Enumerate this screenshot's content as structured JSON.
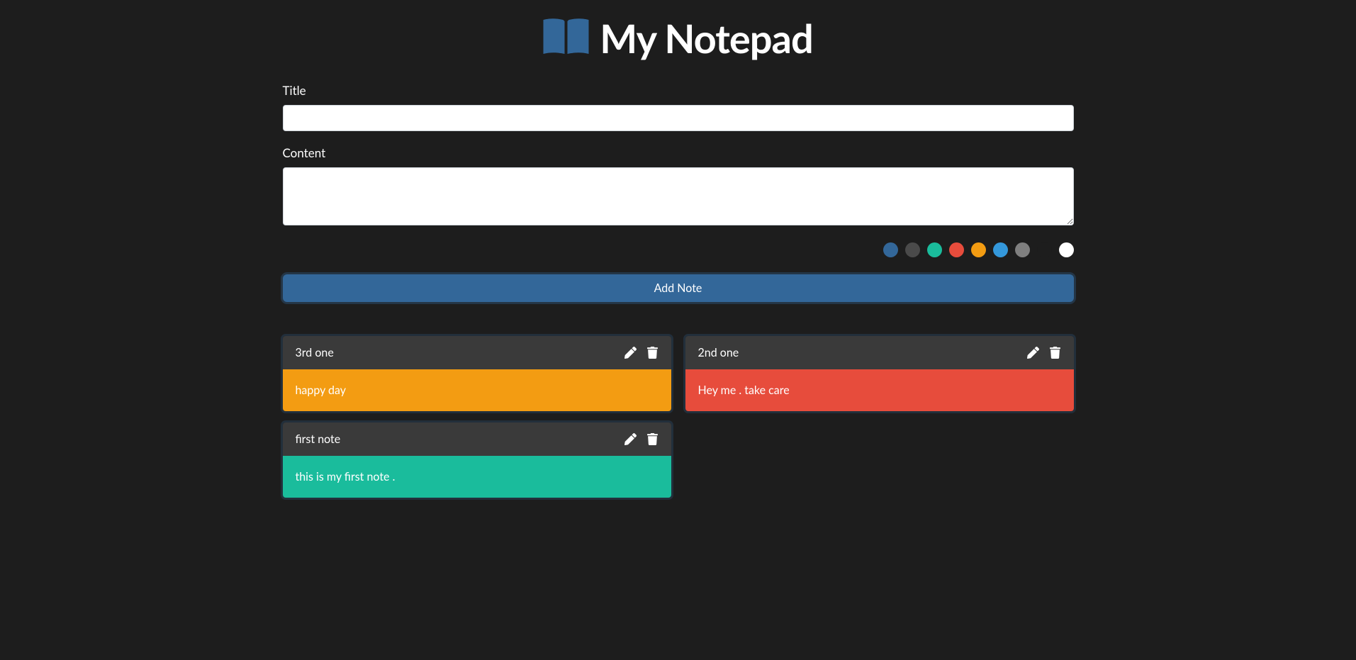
{
  "header": {
    "title": "My Notepad"
  },
  "form": {
    "title_label": "Title",
    "title_value": "",
    "content_label": "Content",
    "content_value": "",
    "add_button": "Add Note"
  },
  "colors": [
    {
      "name": "blue",
      "hex": "#336799"
    },
    {
      "name": "dark-gray",
      "hex": "#4a4a4a"
    },
    {
      "name": "green",
      "hex": "#1abc9c"
    },
    {
      "name": "red",
      "hex": "#e74c3c"
    },
    {
      "name": "orange",
      "hex": "#f39c12"
    },
    {
      "name": "light-blue",
      "hex": "#3498db"
    },
    {
      "name": "gray",
      "hex": "#7f7f7f"
    },
    {
      "name": "black",
      "hex": "#1d1d1d"
    },
    {
      "name": "white",
      "hex": "#ffffff"
    }
  ],
  "notes": [
    {
      "title": "3rd one",
      "content": "happy day",
      "color": "#f39c12"
    },
    {
      "title": "2nd one",
      "content": "Hey me . take care",
      "color": "#e74c3c"
    },
    {
      "title": "first note",
      "content": "this is my first note .",
      "color": "#1abc9c"
    }
  ]
}
